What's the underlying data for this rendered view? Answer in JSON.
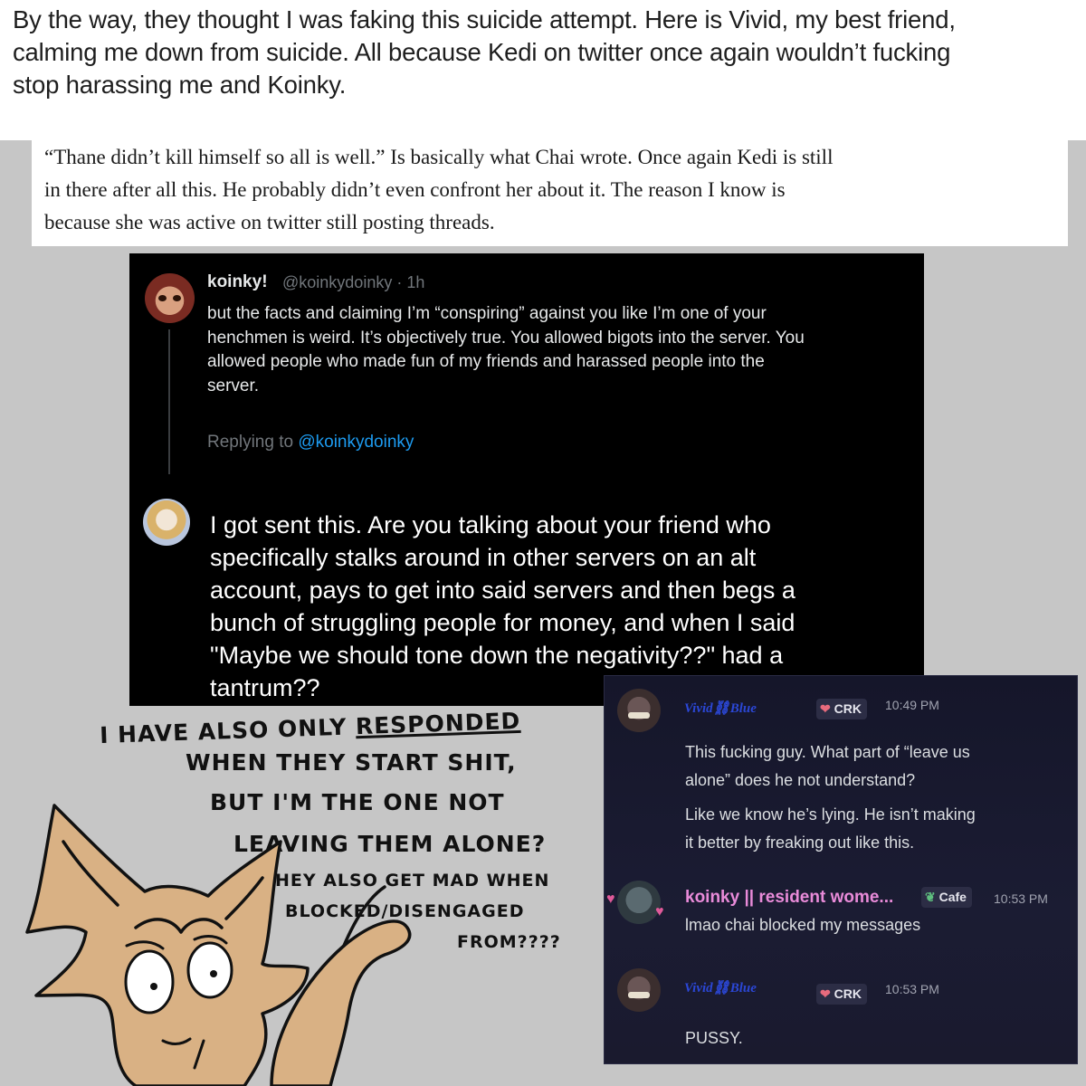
{
  "top_note": {
    "lines": [
      "By the way, they thought I was faking this suicide attempt. Here is Vivid, my best friend,",
      "calming me down from suicide. All because Kedi on twitter once again wouldn’t fucking",
      "stop harassing me and Koinky."
    ]
  },
  "serif_note": {
    "lines": [
      "“Thane didn’t kill himself so all is well.” Is basically what Chai wrote. Once again Kedi is still",
      "in there after all this. He probably didn’t even confront her about it. The reason I know is",
      "because she was active on twitter still posting threads."
    ]
  },
  "tweet": {
    "name": "koinky!",
    "handle": "@koinkydoinky · 1h",
    "body_lines": [
      "but the facts and claiming I’m “conspiring” against you like I’m one of your",
      "henchmen is weird. It’s objectively true. You allowed bigots into the server. You",
      "allowed people who made fun of my friends and harassed people into the",
      "server."
    ],
    "replying_prefix": "Replying to",
    "replying_handle": "@koinkydoinky",
    "reply_lines": [
      "I got sent this. Are you talking about your friend who",
      "specifically stalks around in other servers on an alt",
      "account, pays to get into said servers and then begs a",
      "bunch of struggling people for money, and when I said",
      "\"Maybe we should tone down the negativity??\" had a",
      "tantrum??"
    ]
  },
  "discord": {
    "messages": [
      {
        "user": "Vivid⛓Blue",
        "tag": "CRK",
        "time": "10:49 PM",
        "lines": [
          "This fucking guy. What part of “leave us",
          "alone” does he not understand?",
          "Like we know he’s lying. He isn’t making",
          "it better by freaking out like this."
        ]
      },
      {
        "user": "koinky || resident wome...",
        "tag": "Cafe",
        "time": "10:53 PM",
        "lines": [
          "lmao chai blocked my messages"
        ]
      },
      {
        "user": "Vivid⛓Blue",
        "tag": "CRK",
        "time": "10:53 PM",
        "lines": [
          "PUSSY."
        ]
      }
    ]
  },
  "handwriting": {
    "line1_a": "I HAVE ALSO ONLY ",
    "line1_b": "RESPONDED",
    "line2": "WHEN THEY START SHIT,",
    "line3": "BUT I'M THE ONE NOT",
    "line4": "LEAVING THEM ALONE?",
    "line5": "THEY ALSO GET MAD WHEN",
    "line6": "BLOCKED/DISENGAGED",
    "line7": "FROM????"
  }
}
